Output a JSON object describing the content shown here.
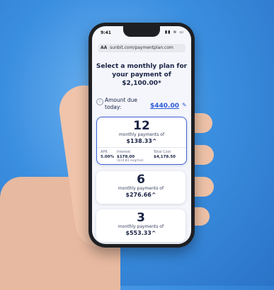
{
  "status": {
    "time": "9:41",
    "icons": "▮▮ ≋ ▭"
  },
  "browser": {
    "aa": "AA",
    "url": "sunbit.com/paymentplan.com"
  },
  "title": "Select a monthly plan for your payment of $2,100.00*",
  "amount": {
    "label": "Amount due today:",
    "value": "$440.00"
  },
  "plans": [
    {
      "months": "12",
      "label": "monthly payments of",
      "payment": "$138.33^",
      "apr_label": "APR",
      "apr": "5.00%",
      "interest_label": "Interest",
      "interest": "$178.00",
      "interest_note": "($14.83 avg/mo)",
      "total_label": "Total Cost",
      "total": "$4,178.50"
    },
    {
      "months": "6",
      "label": "monthly payments of",
      "payment": "$276.66^"
    },
    {
      "months": "3",
      "label": "monthly payments of",
      "payment": "$553.33^"
    }
  ],
  "colors": {
    "accent": "#2c5bd8",
    "background": "#3b8fe0"
  }
}
